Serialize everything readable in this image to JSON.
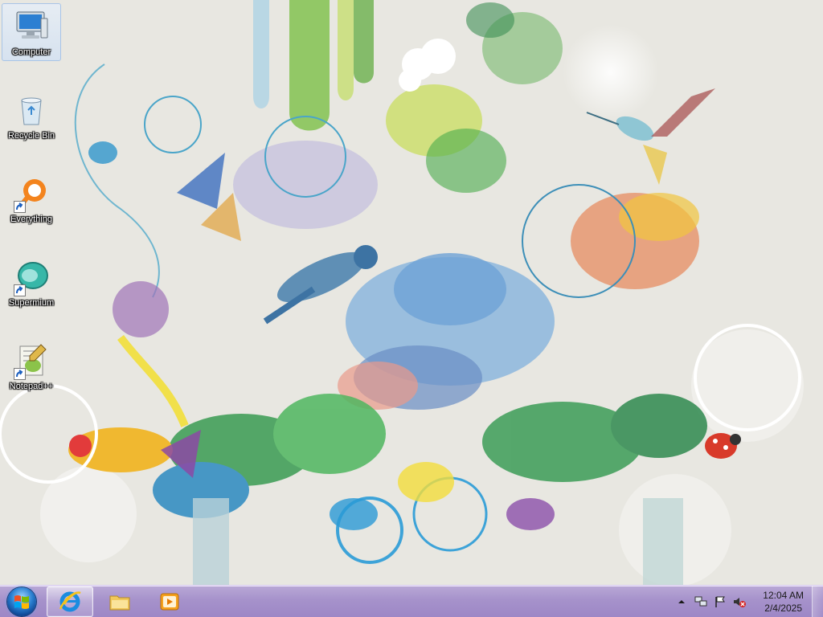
{
  "desktop": {
    "icons": [
      {
        "label": "Computer",
        "icon": "computer-icon",
        "selected": true
      },
      {
        "label": "Recycle Bin",
        "icon": "recycle-bin-icon",
        "selected": false
      },
      {
        "label": "Everything",
        "icon": "everything-search-icon",
        "selected": false
      },
      {
        "label": "Supermium",
        "icon": "supermium-browser-icon",
        "selected": false
      },
      {
        "label": "Notepad++",
        "icon": "notepadpp-icon",
        "selected": false
      }
    ],
    "wallpaper": "watercolor-floral-birds"
  },
  "taskbar": {
    "start": {
      "icon": "windows-start-orb"
    },
    "pinned": [
      {
        "name": "Internet Explorer",
        "icon": "internet-explorer-icon",
        "active": true
      },
      {
        "name": "Windows Explorer",
        "icon": "file-explorer-icon",
        "active": false
      },
      {
        "name": "Windows Media Player",
        "icon": "media-player-icon",
        "active": false
      }
    ],
    "tray": {
      "icons": [
        "show-hidden-icons-arrow",
        "network-icon",
        "action-center-flag-icon",
        "volume-muted-icon"
      ],
      "time": "12:04 AM",
      "date": "2/4/2025"
    },
    "colors": {
      "bar": "#a692cb",
      "accent": "#2a7fd0"
    }
  }
}
